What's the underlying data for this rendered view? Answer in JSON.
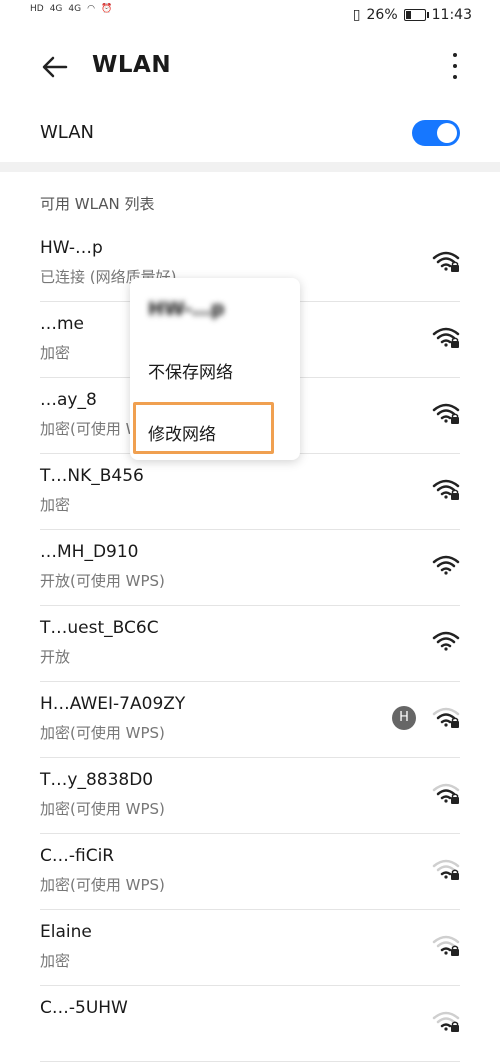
{
  "status_bar": {
    "left_indicators": [
      "HD",
      "4G",
      "4G"
    ],
    "battery_text": "26%",
    "battery_level": 0.26,
    "time": "11:43"
  },
  "header": {
    "title": "WLAN"
  },
  "toggle": {
    "label": "WLAN",
    "on": true,
    "color": "#1677ff"
  },
  "section_title": "可用 WLAN 列表",
  "networks": [
    {
      "name": "HW-…p",
      "sub": "已连接 (网络质量好)",
      "secured": true,
      "signal": "full"
    },
    {
      "name": "…me",
      "sub": "加密",
      "secured": true,
      "signal": "full"
    },
    {
      "name": "…ay_8",
      "sub": "加密(可使用 WPS)",
      "secured": true,
      "signal": "full"
    },
    {
      "name": "T…NK_B456",
      "sub": "加密",
      "secured": true,
      "signal": "full"
    },
    {
      "name": "…MH_D910",
      "sub": "开放(可使用 WPS)",
      "secured": false,
      "signal": "full"
    },
    {
      "name": "T…uest_BC6C",
      "sub": "开放",
      "secured": false,
      "signal": "full"
    },
    {
      "name": "H…AWEI-7A09ZY",
      "sub": "加密(可使用 WPS)",
      "secured": true,
      "signal": "medium",
      "badge": "H"
    },
    {
      "name": "T…y_8838D0",
      "sub": "加密(可使用 WPS)",
      "secured": true,
      "signal": "medium"
    },
    {
      "name": "C…-fiCiR",
      "sub": "加密(可使用 WPS)",
      "secured": true,
      "signal": "weak"
    },
    {
      "name": "Elaine",
      "sub": "加密",
      "secured": true,
      "signal": "weak"
    },
    {
      "name": "C…-5UHW",
      "sub": "",
      "secured": true,
      "signal": "weak"
    }
  ],
  "popup": {
    "title": "HW-…p",
    "options": [
      "不保存网络",
      "修改网络"
    ],
    "highlighted": "修改网络",
    "highlight_color": "#f0a050"
  }
}
